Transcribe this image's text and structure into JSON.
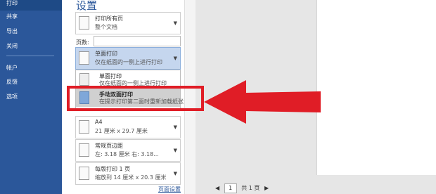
{
  "nav": {
    "items": [
      {
        "label": "打印",
        "active": true
      },
      {
        "label": "共享"
      },
      {
        "label": "导出"
      },
      {
        "label": "关闭"
      },
      {
        "label": "帐户"
      },
      {
        "label": "反馈"
      },
      {
        "label": "选项"
      }
    ]
  },
  "settings": {
    "title": "设置",
    "print_range": {
      "title": "打印所有页",
      "subtitle": "整个文档"
    },
    "pages_label": "页数:",
    "duplex": {
      "title": "单面打印",
      "subtitle": "仅在纸面的一侧上进行打印"
    },
    "duplex_options": [
      {
        "title": "单面打印",
        "subtitle": "仅在纸面的一侧上进行打印"
      },
      {
        "title": "手动双面打印",
        "subtitle": "在提示打印第二面时重新加载纸张"
      }
    ],
    "paper": {
      "title": "A4",
      "subtitle": "21 厘米 x 29.7 厘米"
    },
    "margins": {
      "title": "常规页边距",
      "subtitle": "左:  3.18 厘米    右:  3.18..."
    },
    "pages_per_sheet": {
      "title": "每版打印 1 页",
      "subtitle": "缩放到 14 厘米 x 20.3 厘米"
    },
    "page_setup_link": "页面设置"
  },
  "preview": {
    "page_number": "1",
    "page_total": "共 1 页"
  },
  "colors": {
    "nav_bg": "#2b579a",
    "highlight_arrow": "#e01d26"
  }
}
